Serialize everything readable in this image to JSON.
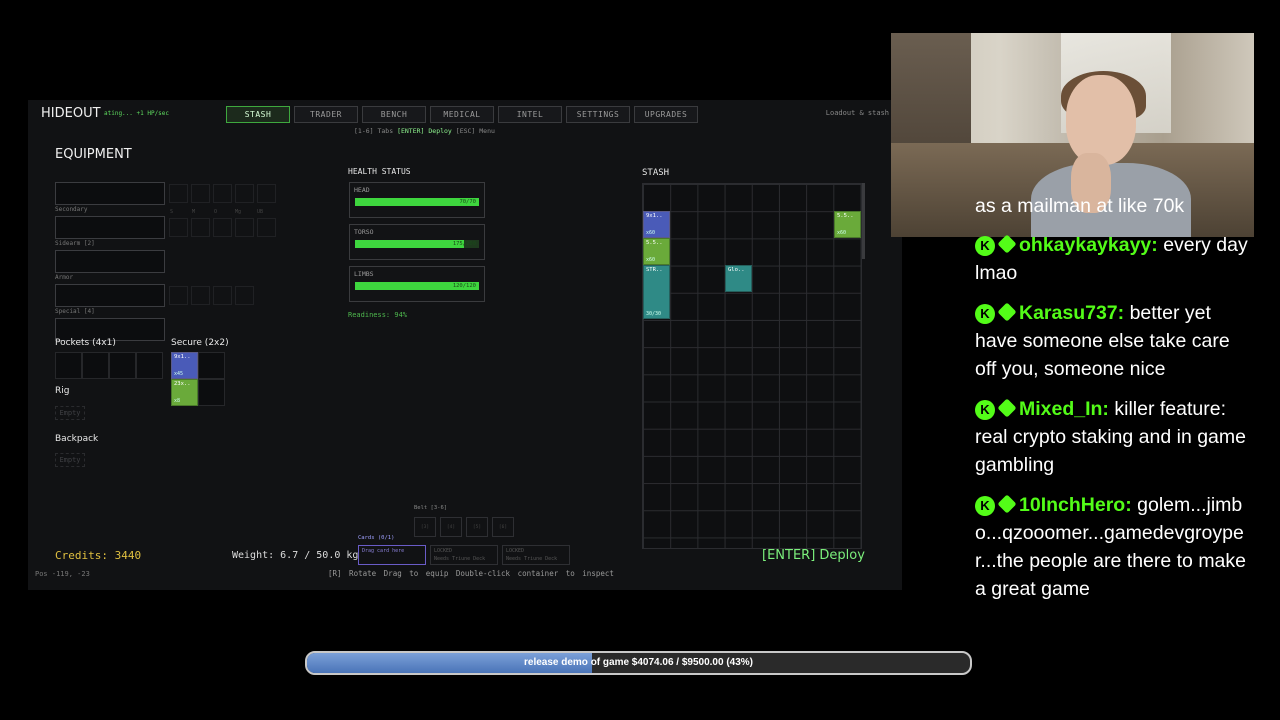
{
  "game": {
    "title": "HIDEOUT",
    "status_small": "ating... +1 HP/sec",
    "tabs": [
      "STASH",
      "TRADER",
      "BENCH",
      "MEDICAL",
      "INTEL",
      "SETTINGS",
      "UPGRADES"
    ],
    "active_tab": "STASH",
    "loadout_hint": "Loadout & stash",
    "tabs_hint": {
      "prefix": "[1-6] Tabs",
      "highlight": "[ENTER] Deploy",
      "suffix": "[ESC] Menu"
    },
    "equipment": {
      "title": "EQUIPMENT",
      "labels": {
        "secondary": "Secondary",
        "sidearm": "Sidearm [2]",
        "armor": "Armor",
        "special": "Special [4]"
      },
      "mini_slot_labels": [
        "S",
        "M",
        "O",
        "Mg",
        "UB"
      ],
      "pockets_title": "Pockets (4x1)",
      "secure_title": "Secure (2x2)",
      "secure_items": [
        {
          "name": "9x1..",
          "count": "x45"
        },
        {
          "name": "23x..",
          "count": "x8"
        }
      ],
      "rig_title": "Rig",
      "rig_empty": "Empty",
      "backpack_title": "Backpack",
      "backpack_empty": "Empty"
    },
    "health": {
      "title": "HEALTH STATUS",
      "parts": [
        {
          "name": "HEAD",
          "value": "70/70",
          "fraction": 1.0
        },
        {
          "name": "TORSO",
          "value": "175/200",
          "fraction": 0.875
        },
        {
          "name": "LIMBS",
          "value": "120/120",
          "fraction": 1.0
        }
      ],
      "readiness": "Readiness: 94%"
    },
    "stash": {
      "title": "STASH",
      "items": [
        {
          "name": "9x1..",
          "count": "x60",
          "color": "#4a5bb8"
        },
        {
          "name": "5.5..",
          "count": "x60",
          "color": "#6aaa3a"
        },
        {
          "name": "STR..",
          "count": "30/30",
          "color": "#2f8a86"
        },
        {
          "name": "Glo..",
          "count": "",
          "color": "#2f8a86"
        },
        {
          "name": "5.5..",
          "count": "x60",
          "color": "#6aaa3a"
        }
      ]
    },
    "credits": "Credits: 3440",
    "pos": "Pos -119, -23",
    "weight": "Weight: 6.7 / 50.0 kg",
    "deploy": "[ENTER] Deploy",
    "bottom_hints": "[R] Rotate   Drag to equip   Double-click container to inspect",
    "cards_label": "Cards (0/1)",
    "belt_label": "Belt [3-6]",
    "belt_slots": [
      "[3]",
      "[4]",
      "[5]",
      "[6]"
    ],
    "cards": [
      {
        "line1": "Drag card here",
        "line2": ""
      },
      {
        "line1": "LOCKED",
        "line2": "Needs Triune Deck"
      },
      {
        "line1": "LOCKED",
        "line2": "Needs Triune Deck"
      }
    ]
  },
  "chat": {
    "partial_top": "as a mailman at like 70k",
    "messages": [
      {
        "user": "ohkaykaykayy:",
        "text": "every day lmao"
      },
      {
        "user": "Karasu737:",
        "text": "better yet have someone else take care off you, someone nice"
      },
      {
        "user": "Mixed_In:",
        "text": "killer feature: real crypto staking and in game gambling"
      },
      {
        "user": "10InchHero:",
        "text": "golem...jimbo...qzooomer...gamedevgroyper...the people are there to make a great game"
      }
    ],
    "badge_letter": "K"
  },
  "goal": {
    "text": "release demo of game $4074.06 / $9500.00 (43%)",
    "fraction": 0.43
  },
  "colors": {
    "accent": "#53fc18",
    "credits": "#e0c040",
    "deploy": "#7cf07c"
  }
}
